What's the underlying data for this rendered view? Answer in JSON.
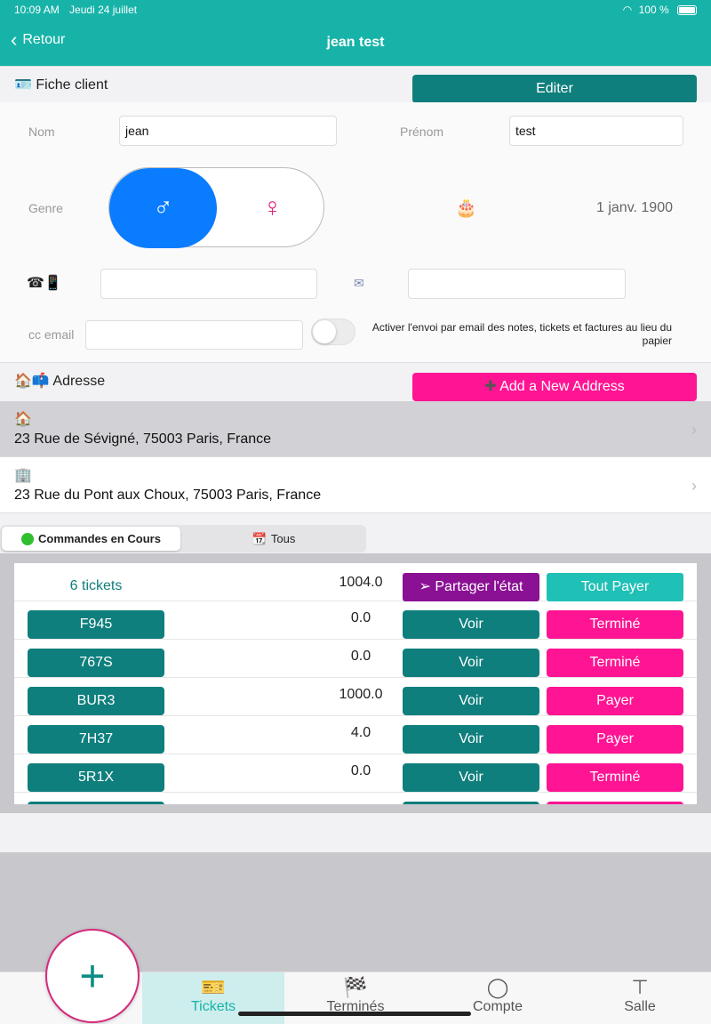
{
  "status": {
    "time": "10:09 AM",
    "date": "Jeudi 24 juillet",
    "battery": "100 %"
  },
  "nav": {
    "back_label": "Retour",
    "title": "jean test"
  },
  "client": {
    "section_title": "Fiche client",
    "edit_label": "Editer",
    "nom_label": "Nom",
    "nom_value": "jean",
    "prenom_label": "Prénom",
    "prenom_value": "test",
    "genre_label": "Genre",
    "male_symbol": "♂",
    "female_symbol": "♀",
    "birthday": "1 janv. 1900",
    "cc_email_label": "cc email",
    "email_toggle_text": "Activer l'envoi par email des notes, tickets et factures au lieu du papier"
  },
  "address": {
    "section_title": "Adresse",
    "add_label": "Add a New Address",
    "items": [
      {
        "icon": "🏠",
        "text": "23 Rue de Sévigné, 75003 Paris, France"
      },
      {
        "icon": "🏢",
        "text": "23 Rue du Pont aux Choux, 75003 Paris, France"
      }
    ]
  },
  "segments": {
    "active": "Commandes en Cours",
    "other": "Tous"
  },
  "tickets": {
    "count_label": "6 tickets",
    "total": "1004.0",
    "share_label": "Partager l'état",
    "pay_all_label": "Tout Payer",
    "view_label": "Voir",
    "rows": [
      {
        "code": "F945",
        "amount": "0.0",
        "action": "Terminé"
      },
      {
        "code": "767S",
        "amount": "0.0",
        "action": "Terminé"
      },
      {
        "code": "BUR3",
        "amount": "1000.0",
        "action": "Payer"
      },
      {
        "code": "7H37",
        "amount": "4.0",
        "action": "Payer"
      },
      {
        "code": "5R1X",
        "amount": "0.0",
        "action": "Terminé"
      }
    ]
  },
  "tabs": [
    {
      "label": "Tickets",
      "icon": "ticket-icon"
    },
    {
      "label": "Terminés",
      "icon": "checkered-flag-icon"
    },
    {
      "label": "Compte",
      "icon": "person-circle-icon"
    },
    {
      "label": "Salle",
      "icon": "table-icon"
    }
  ],
  "colors": {
    "primary": "#17b3a8",
    "teal_button": "#0f7f7d",
    "pink": "#ff1493",
    "purple": "#8a1094",
    "blue": "#0a7cff"
  }
}
